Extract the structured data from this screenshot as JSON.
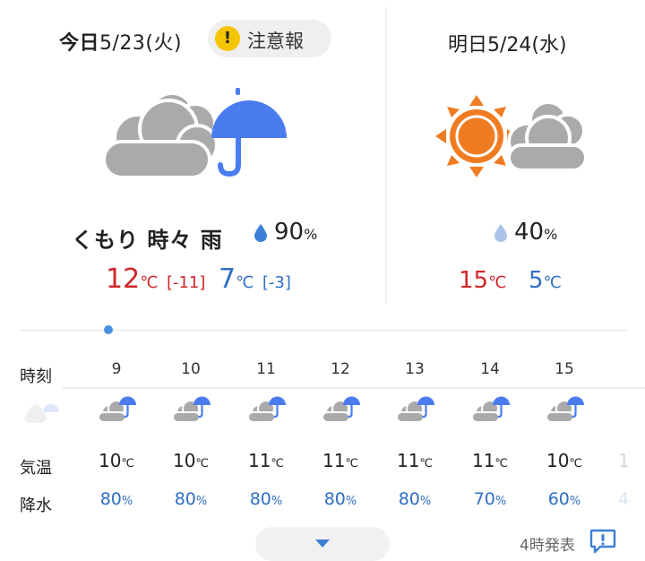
{
  "today": {
    "label": "今日",
    "date": "5/23(火)",
    "warning_label": "注意報",
    "warning_mark": "!",
    "condition": "くもり 時々 雨",
    "precip_prob": "90",
    "precip_unit": "%",
    "high": "12",
    "high_diff": "[-11]",
    "low": "7",
    "low_diff": "[-3]",
    "unit": "℃",
    "icon": "cloud-umbrella-icon"
  },
  "tomorrow": {
    "label": "明日",
    "date": "5/24(水)",
    "precip_prob": "40",
    "precip_unit": "%",
    "high": "15",
    "low": "5",
    "unit": "℃",
    "icon": "sun-cloud-icon"
  },
  "hourly": {
    "labels": {
      "time": "時刻",
      "temp": "気温",
      "precip": "降水"
    },
    "temp_unit": "℃",
    "precip_unit": "%",
    "hours": [
      {
        "hour": "9",
        "temp": "10",
        "pop": "80"
      },
      {
        "hour": "10",
        "temp": "10",
        "pop": "80"
      },
      {
        "hour": "11",
        "temp": "11",
        "pop": "80"
      },
      {
        "hour": "12",
        "temp": "11",
        "pop": "80"
      },
      {
        "hour": "13",
        "temp": "11",
        "pop": "80"
      },
      {
        "hour": "14",
        "temp": "11",
        "pop": "70"
      },
      {
        "hour": "15",
        "temp": "10",
        "pop": "60"
      }
    ],
    "partial_right": {
      "temp": "1",
      "pop": "4"
    }
  },
  "footer": {
    "issued": "4時発表"
  },
  "colors": {
    "high": "#d0262a",
    "low": "#2f6fc4",
    "umbrella": "#4a7cf0",
    "cloud": "#aaaaaa",
    "sun": "#f07c22",
    "warning": "#f5c400"
  }
}
